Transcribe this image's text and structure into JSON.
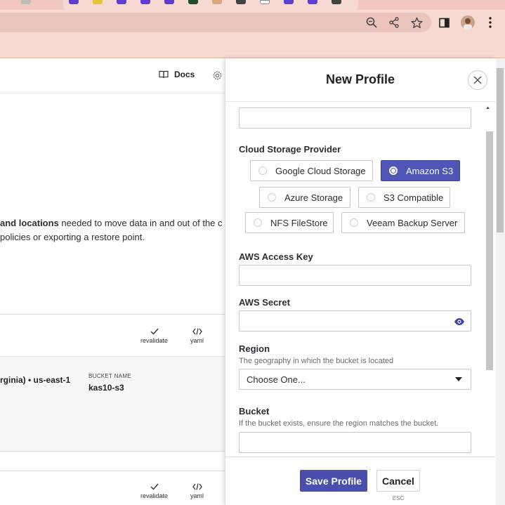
{
  "browser": {
    "icons": [
      "zoom-icon",
      "share-icon",
      "star-icon",
      "side-panel-icon",
      "profile-avatar",
      "menu-icon"
    ]
  },
  "background_page": {
    "docs_label": "Docs",
    "intro_bold": "and locations",
    "intro_rest": " needed to move data in and out of the c",
    "intro_line2": "policies or exporting a restore point.",
    "actions": {
      "revalidate_label": "revalidate",
      "yaml_label": "yaml"
    },
    "profile_row": {
      "region": "rginia) • us-east-1",
      "bucket_caption": "BUCKET NAME",
      "bucket_name": "kas10-s3"
    }
  },
  "modal": {
    "title": "New Profile",
    "cloud_provider_label": "Cloud Storage Provider",
    "providers": [
      {
        "label": "Google Cloud Storage",
        "selected": false
      },
      {
        "label": "Amazon S3",
        "selected": true
      },
      {
        "label": "Azure Storage",
        "selected": false
      },
      {
        "label": "S3 Compatible",
        "selected": false
      },
      {
        "label": "NFS FileStore",
        "selected": false
      },
      {
        "label": "Veeam Backup Server",
        "selected": false
      }
    ],
    "access_key_label": "AWS Access Key",
    "access_key_value": "",
    "secret_label": "AWS Secret",
    "secret_value": "",
    "region_label": "Region",
    "region_hint": "The geography in which the bucket is located",
    "region_selected": "Choose One...",
    "bucket_label": "Bucket",
    "bucket_hint": "If the bucket exists, ensure the region matches the bucket.",
    "bucket_value": "",
    "save_label": "Save Profile",
    "cancel_label": "Cancel",
    "cancel_shortcut": "ESC"
  },
  "colors": {
    "accent": "#4a4fae",
    "selected_radio": "#5056b6",
    "chrome": "#f6d9d1"
  }
}
